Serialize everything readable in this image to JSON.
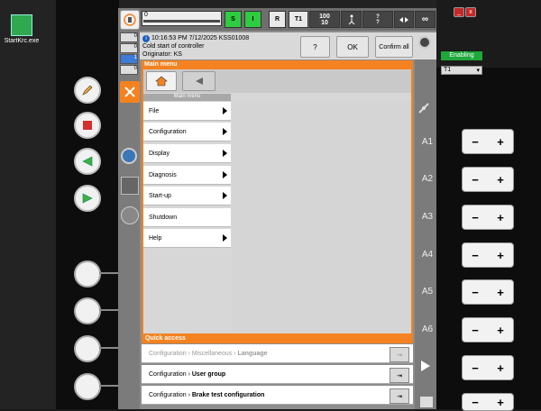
{
  "desktop": {
    "icon_label": "StartKrc.exe"
  },
  "window_controls": {
    "minimize": "_",
    "close": "x"
  },
  "status_bar": {
    "program_field": "0",
    "s_label": "S",
    "i_label": "I",
    "r_label": "R",
    "mode_label": "T1",
    "override_top": "100",
    "override_bottom": "10",
    "tool_top": "?",
    "tool_bottom": "?",
    "infinity": "∞"
  },
  "left_counters": [
    "0",
    "0",
    "1",
    "0"
  ],
  "message": {
    "time_line": "10:16:53 PM 7/12/2025 KSS01008",
    "text": "Cold start of controller",
    "originator": "Originator: KS",
    "help_label": "?",
    "ok_label": "OK",
    "confirm_all_label": "Confirm all"
  },
  "enabling": {
    "label": "Enabling",
    "mode_select": "T1"
  },
  "main_menu": {
    "title": "Main menu",
    "subtitle": "Main menu",
    "items": [
      {
        "label": "File"
      },
      {
        "label": "Configuration"
      },
      {
        "label": "Display"
      },
      {
        "label": "Diagnosis"
      },
      {
        "label": "Start-up"
      },
      {
        "label": "Shutdown"
      },
      {
        "label": "Help"
      }
    ]
  },
  "quick_access": {
    "title": "Quick access",
    "rows": [
      {
        "prefix": "Configuration",
        "mid": "Miscellaneous",
        "label": "Language"
      },
      {
        "prefix": "Configuration",
        "label": "User group"
      },
      {
        "prefix": "Configuration",
        "label": "Brake test configuration"
      }
    ]
  },
  "jog": {
    "axes": [
      "A1",
      "A2",
      "A3",
      "A4",
      "A5",
      "A6"
    ],
    "minus": "−",
    "plus": "+"
  }
}
